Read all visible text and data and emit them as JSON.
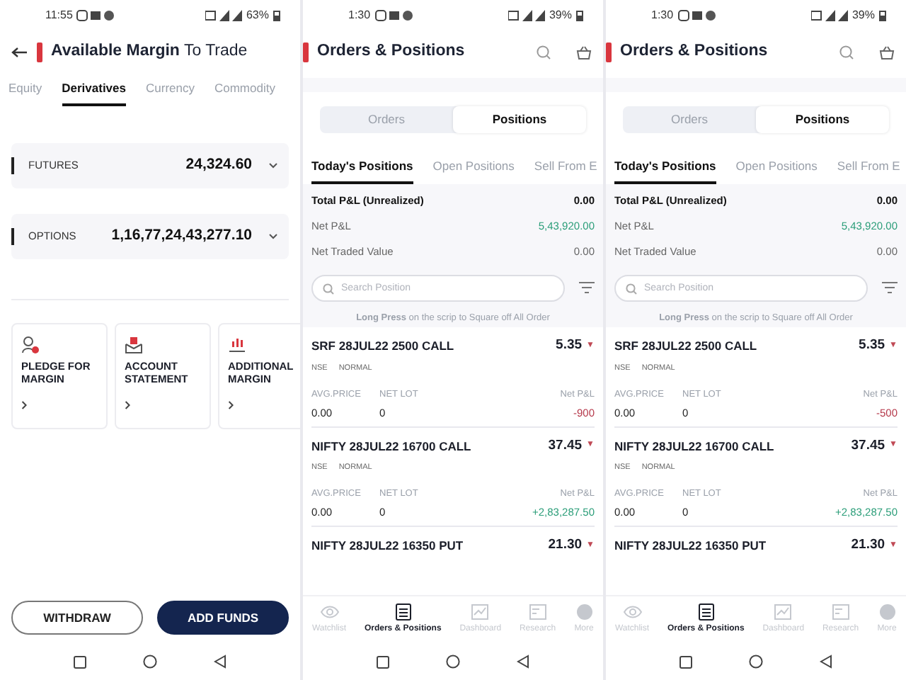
{
  "screens": [
    {
      "kind": "margin",
      "status_bar": {
        "time": "11:55",
        "battery": "63%"
      },
      "title": "**Available Margin** To Trade",
      "tabs": [
        {
          "label": "Equity",
          "selected": false
        },
        {
          "label": "Derivatives",
          "selected": true
        },
        {
          "label": "Currency",
          "selected": false
        },
        {
          "label": "Commodity",
          "selected": false
        }
      ],
      "margins": [
        {
          "label": "FUTURES",
          "value": "24,324.60"
        },
        {
          "label": "OPTIONS",
          "value": "1,16,77,24,43,277.10"
        }
      ],
      "cards": [
        {
          "kind": "pledge",
          "label": "PLEDGE FOR MARGIN"
        },
        {
          "kind": "statement",
          "label": "ACCOUNT STATEMENT"
        },
        {
          "kind": "additional",
          "label": "ADDITIONAL MARGIN"
        }
      ],
      "buttons": [
        {
          "kind": "outline",
          "label": "WITHDRAW"
        },
        {
          "kind": "primary",
          "label": "ADD FUNDS"
        }
      ]
    },
    {
      "kind": "positions",
      "status_bar": {
        "time": "1:30",
        "battery": "39%"
      },
      "title": "Orders & Positions",
      "segments": [
        {
          "label": "Orders",
          "selected": false
        },
        {
          "label": "Positions",
          "selected": true
        }
      ],
      "tabs": [
        {
          "label": "Today's Positions",
          "selected": true
        },
        {
          "label": "Open Positions",
          "selected": false
        },
        {
          "label": "Sell From E",
          "selected": false
        }
      ],
      "summary": [
        {
          "kind": "total",
          "label": "Total P&L (Unrealized)",
          "value": "0.00"
        },
        {
          "kind": "pnl",
          "label": "Net P&L",
          "value": "5,43,920.00"
        },
        {
          "kind": "plain",
          "label": "Net Traded Value",
          "value": "0.00"
        }
      ],
      "search": {
        "placeholder": "Search Position"
      },
      "hint": "**Long Press** on the scrip to Square off All Order",
      "positions": [
        {
          "name": "SRF 28JUL22 2500 CALL",
          "price": "5.35",
          "arrow": "▼",
          "exchange": "NSE",
          "type": "NORMAL",
          "avg_label": "AVG.PRICE",
          "avg": "0.00",
          "lot_label": "NET LOT",
          "lot": "0",
          "pnl_label": "Net P&L",
          "pnl": {
            "text": "-900",
            "color": "#b5384a"
          }
        },
        {
          "name": "NIFTY 28JUL22 16700 CALL",
          "price": "37.45",
          "arrow": "▼",
          "exchange": "NSE",
          "type": "NORMAL",
          "avg_label": "AVG.PRICE",
          "avg": "0.00",
          "lot_label": "NET LOT",
          "lot": "0",
          "pnl_label": "Net P&L",
          "pnl": {
            "text": "+2,83,287.50",
            "color": "#2a9d78"
          }
        },
        {
          "name": "NIFTY 28JUL22 16350 PUT",
          "price": "21.30",
          "arrow": "▼"
        }
      ],
      "nav": [
        {
          "kind": "eye",
          "label": "Watchlist",
          "selected": false
        },
        {
          "kind": "list",
          "label": "Orders & Positions",
          "selected": true
        },
        {
          "kind": "chart",
          "label": "Dashboard",
          "selected": false
        },
        {
          "kind": "research",
          "label": "Research",
          "selected": false
        },
        {
          "kind": "avatar",
          "label": "More",
          "selected": false
        }
      ]
    },
    {
      "kind": "positions",
      "status_bar": {
        "time": "1:30",
        "battery": "39%"
      },
      "title": "Orders & Positions",
      "segments": [
        {
          "label": "Orders",
          "selected": false
        },
        {
          "label": "Positions",
          "selected": true
        }
      ],
      "tabs": [
        {
          "label": "Today's Positions",
          "selected": true
        },
        {
          "label": "Open Positions",
          "selected": false
        },
        {
          "label": "Sell From E",
          "selected": false
        }
      ],
      "summary": [
        {
          "kind": "total",
          "label": "Total P&L (Unrealized)",
          "value": "0.00"
        },
        {
          "kind": "pnl",
          "label": "Net P&L",
          "value": "5,43,920.00"
        },
        {
          "kind": "plain",
          "label": "Net Traded Value",
          "value": "0.00"
        }
      ],
      "search": {
        "placeholder": "Search Position"
      },
      "hint": "**Long Press** on the scrip to Square off All Order",
      "positions": [
        {
          "name": "SRF 28JUL22 2500 CALL",
          "price": "5.35",
          "arrow": "▼",
          "exchange": "NSE",
          "type": "NORMAL",
          "avg_label": "AVG.PRICE",
          "avg": "0.00",
          "lot_label": "NET LOT",
          "lot": "0",
          "pnl_label": "Net P&L",
          "pnl": {
            "text": "-500",
            "color": "#b5384a"
          }
        },
        {
          "name": "NIFTY 28JUL22 16700 CALL",
          "price": "37.45",
          "arrow": "▼",
          "exchange": "NSE",
          "type": "NORMAL",
          "avg_label": "AVG.PRICE",
          "avg": "0.00",
          "lot_label": "NET LOT",
          "lot": "0",
          "pnl_label": "Net P&L",
          "pnl": {
            "text": "+2,83,287.50",
            "color": "#2a9d78"
          }
        },
        {
          "name": "NIFTY 28JUL22 16350 PUT",
          "price": "21.30",
          "arrow": "▼"
        }
      ],
      "nav": [
        {
          "kind": "eye",
          "label": "Watchlist",
          "selected": false
        },
        {
          "kind": "list",
          "label": "Orders & Positions",
          "selected": true
        },
        {
          "kind": "chart",
          "label": "Dashboard",
          "selected": false
        },
        {
          "kind": "research",
          "label": "Research",
          "selected": false
        },
        {
          "kind": "avatar",
          "label": "More",
          "selected": false
        }
      ]
    }
  ]
}
